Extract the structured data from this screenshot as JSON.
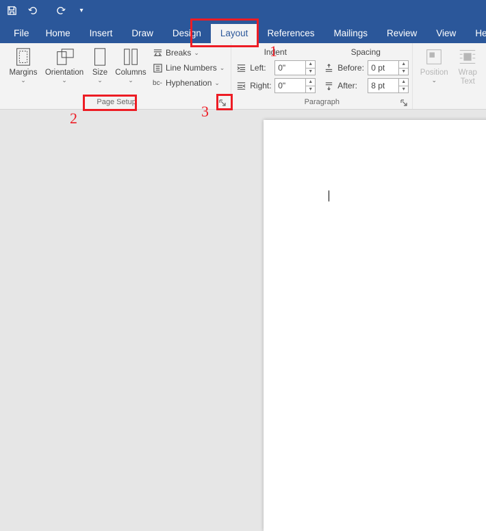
{
  "qat": {
    "save": "save",
    "undo": "undo",
    "redo": "redo"
  },
  "tabs": {
    "file": "File",
    "items": [
      "Home",
      "Insert",
      "Draw",
      "Design",
      "Layout",
      "References",
      "Mailings",
      "Review",
      "View",
      "Help"
    ],
    "active_index": 4
  },
  "page_setup": {
    "margins": "Margins",
    "orientation": "Orientation",
    "size": "Size",
    "columns": "Columns",
    "breaks": "Breaks",
    "line_numbers": "Line Numbers",
    "hyphenation": "Hyphenation",
    "group_label": "Page Setup"
  },
  "paragraph": {
    "indent_heading": "Indent",
    "spacing_heading": "Spacing",
    "left_label": "Left:",
    "right_label": "Right:",
    "before_label": "Before:",
    "after_label": "After:",
    "left_value": "0\"",
    "right_value": "0\"",
    "before_value": "0 pt",
    "after_value": "8 pt",
    "group_label": "Paragraph"
  },
  "arrange": {
    "position": "Position",
    "wrap_text": "Wrap\nText"
  },
  "annotations": {
    "one": "1",
    "two": "2",
    "three": "3"
  }
}
